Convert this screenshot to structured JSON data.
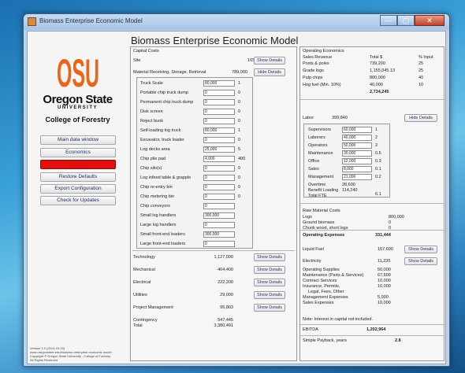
{
  "window": {
    "title": "Biomass Enterprise Economic Model",
    "min": "—",
    "max": "▢",
    "close": "✕"
  },
  "sidebar": {
    "logo_text": "OSU",
    "wordmark1": "Oregon State",
    "wordmark2": "UNIVERSITY",
    "college": "College of Forestry",
    "buttons": [
      {
        "label": "Main data window"
      },
      {
        "label": "Economics"
      },
      {
        "label": "Run Model"
      },
      {
        "label": "Restore Defaults"
      },
      {
        "label": "Export Configuration"
      },
      {
        "label": "Check for Updates"
      }
    ],
    "version": "Version 1.0 (2014-10-20)\nwww.oregonstate.edu/biomass enterprise economic model\nCopyright © Oregon State University - College of Forestry\nAll Rights Reserved"
  },
  "app_title": "Biomass Enterprise Economic Model",
  "capital": {
    "header": "Capital Costs",
    "site_label": "Site",
    "site_value": "165,640",
    "material_label": "Material Receiving, Storage, Retrieval",
    "material_value": "789,000",
    "show_details": "Show Details",
    "hide_details": "Hide Details",
    "items": [
      {
        "label": "Truck Scale",
        "cost": "80,000",
        "qty": "1"
      },
      {
        "label": "Portable chip truck dump",
        "cost": "0",
        "qty": "0"
      },
      {
        "label": "Permanent chip truck dump",
        "cost": "0",
        "qty": "0"
      },
      {
        "label": "Disk screen",
        "cost": "0",
        "qty": "0"
      },
      {
        "label": "Reject bunk",
        "cost": "0",
        "qty": "0"
      },
      {
        "label": "Self-loading log truck",
        "cost": "80,000",
        "qty": "1"
      },
      {
        "label": "Excavator, truck loader",
        "cost": "0",
        "qty": "0"
      },
      {
        "label": "Log decks area",
        "cost": "25,000",
        "qty": "5"
      },
      {
        "label": "Chip pile pad",
        "cost": "4,000",
        "qty": "400"
      },
      {
        "label": "Chip silo(s)",
        "cost": "0",
        "qty": "0"
      },
      {
        "label": "Log infeed table & grapple",
        "cost": "0",
        "qty": "0"
      },
      {
        "label": "Chip re-entry bin",
        "cost": "0",
        "qty": "0"
      },
      {
        "label": "Chip metering bin",
        "cost": "0",
        "qty": "0"
      },
      {
        "label": "Chip conveyors",
        "cost": "0",
        "qty": ""
      },
      {
        "label": "Small log handlers",
        "cost": "300,000",
        "qty": ""
      },
      {
        "label": "Large log handlers",
        "cost": "0",
        "qty": ""
      },
      {
        "label": "Small front-end loaders",
        "cost": "300,000",
        "qty": ""
      },
      {
        "label": "Large front-end loaders",
        "cost": "0",
        "qty": ""
      }
    ],
    "rows": [
      {
        "label": "Technology",
        "value": "1,127,000"
      },
      {
        "label": "Mechanical",
        "value": "404,400"
      },
      {
        "label": "Electrical",
        "value": "222,200"
      },
      {
        "label": "Utilities",
        "value": "29,000"
      },
      {
        "label": "Project Management",
        "value": "95,803"
      }
    ],
    "contingency_label": "Contingency",
    "contingency_value": "547,445",
    "total_label": "Total",
    "total_value": "3,380,491"
  },
  "operating": {
    "header": "Operating Economics",
    "col_total": "Total $",
    "col_pct": "% Input",
    "revenue_label": "Sales Revenue",
    "revenue": [
      {
        "label": "Posts & poles",
        "total": "739,200",
        "pct": "25"
      },
      {
        "label": "Grade logs",
        "total": "1,155,045.13",
        "pct": "25"
      },
      {
        "label": "Pulp chips",
        "total": "800,000",
        "pct": "40"
      },
      {
        "label": "Hog fuel (Min. 10%)",
        "total": "40,000",
        "pct": "10"
      }
    ],
    "revenue_total": "2,734,245"
  },
  "labor": {
    "label": "Labor",
    "value": "399,840",
    "hide_details": "Hide Details",
    "items": [
      {
        "label": "Supervisors",
        "wage": "60,000",
        "n": "1"
      },
      {
        "label": "Laborers",
        "wage": "40,000",
        "n": "2"
      },
      {
        "label": "Operators",
        "wage": "50,000",
        "n": "2"
      },
      {
        "label": "Maintenance",
        "wage": "30,000",
        "n": "0.5"
      },
      {
        "label": "Office",
        "wage": "12,000",
        "n": "0.3"
      },
      {
        "label": "Sales",
        "wage": "8,000",
        "n": "0.1"
      },
      {
        "label": "Management",
        "wage": "21,000",
        "n": "0.2"
      }
    ],
    "overtime_label": "Overtime",
    "overtime_value": "28,600",
    "benefit_label": "Benefit Loading",
    "benefit_value": "114,240",
    "fte_label": "Total FTE",
    "fte_value": "6.1"
  },
  "raw_material": {
    "header": "Raw Material Costs",
    "items": [
      {
        "label": "Logs",
        "value": "800,000"
      },
      {
        "label": "Ground biomass",
        "value": "0"
      },
      {
        "label": "Chunk wood, short logs",
        "value": "0"
      }
    ]
  },
  "opex": {
    "label": "Operating Expenses",
    "value": "331,444",
    "show_details": "Show Details",
    "items": [
      {
        "label": "Liquid Fuel",
        "value": "167,600"
      },
      {
        "label": "Electricity",
        "value": "11,235"
      },
      {
        "label": "Operating Supplies",
        "value": "50,000"
      },
      {
        "label": "Maintenance (Parts & Services)",
        "value": "67,609"
      },
      {
        "label": "Contract Services",
        "value": "10,000"
      },
      {
        "label": "Insurance, Permits,",
        "value": "10,000"
      },
      {
        "label": "Legal, Fees, Other",
        "value": ""
      },
      {
        "label": "Management Expenses",
        "value": "5,000"
      },
      {
        "label": "Sales Expenses",
        "value": "10,000"
      }
    ],
    "note": "Note: Interest in capital not included."
  },
  "ebitda": {
    "label": "EBITDA",
    "value": "1,202,964"
  },
  "payback": {
    "label": "Simple Payback, years",
    "value": "2.8"
  }
}
